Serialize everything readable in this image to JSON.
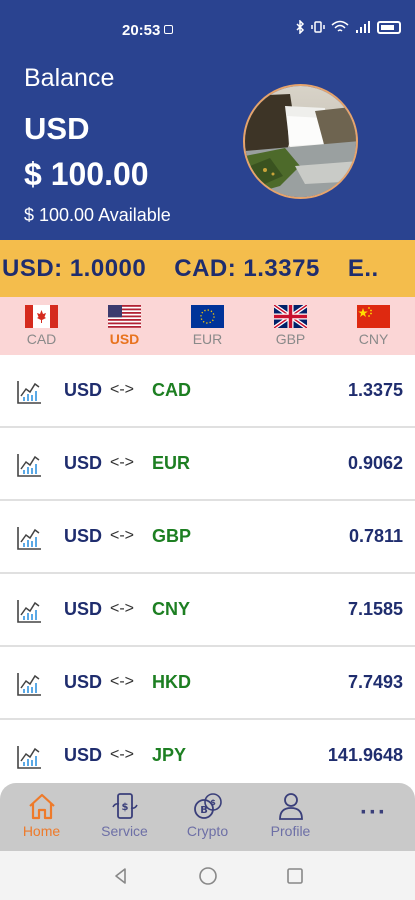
{
  "status": {
    "time": "20:53"
  },
  "balance": {
    "title": "Balance",
    "currency": "USD",
    "amount": "$ 100.00",
    "available": "$ 100.00  Available"
  },
  "ticker": {
    "items": [
      "USD: 1.0000",
      "CAD: 1.3375",
      "E.."
    ]
  },
  "currency_tabs": [
    {
      "code": "CAD",
      "flag": "canada-flag",
      "active": false
    },
    {
      "code": "USD",
      "flag": "usa-flag",
      "active": true
    },
    {
      "code": "EUR",
      "flag": "eu-flag",
      "active": false
    },
    {
      "code": "GBP",
      "flag": "uk-flag",
      "active": false
    },
    {
      "code": "CNY",
      "flag": "china-flag",
      "active": false
    }
  ],
  "rates": [
    {
      "base": "USD",
      "arrow": "<->",
      "target": "CAD",
      "value": "1.3375"
    },
    {
      "base": "USD",
      "arrow": "<->",
      "target": "EUR",
      "value": "0.9062"
    },
    {
      "base": "USD",
      "arrow": "<->",
      "target": "GBP",
      "value": "0.7811"
    },
    {
      "base": "USD",
      "arrow": "<->",
      "target": "CNY",
      "value": "7.1585"
    },
    {
      "base": "USD",
      "arrow": "<->",
      "target": "HKD",
      "value": "7.7493"
    },
    {
      "base": "USD",
      "arrow": "<->",
      "target": "JPY",
      "value": "141.9648"
    }
  ],
  "nav": [
    {
      "label": "Home",
      "icon": "home-icon",
      "active": true
    },
    {
      "label": "Service",
      "icon": "service-icon",
      "active": false
    },
    {
      "label": "Crypto",
      "icon": "crypto-icon",
      "active": false
    },
    {
      "label": "Profile",
      "icon": "profile-icon",
      "active": false
    },
    {
      "label": "",
      "icon": "more-icon",
      "active": false
    }
  ],
  "colors": {
    "header": "#2a4390",
    "ticker": "#f4bd4c",
    "tabs_bg": "#fbd6d6",
    "active_accent": "#ee7a2a",
    "rate_base": "#1f2d6e",
    "rate_target": "#1d7f22"
  }
}
